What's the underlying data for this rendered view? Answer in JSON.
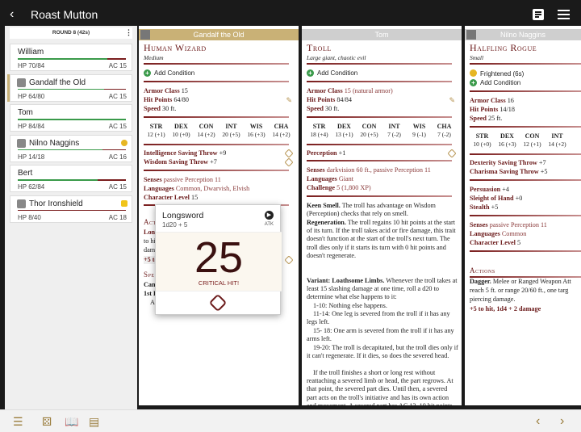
{
  "topbar": {
    "title": "Roast Mutton"
  },
  "sidebar": {
    "round": "ROUND 8 (42s)",
    "combatants": [
      {
        "name": "William",
        "hp": "HP 70/84",
        "ac": "AC 15",
        "hp_fraction": 0.83,
        "avatar": false,
        "active": false,
        "badge": ""
      },
      {
        "name": "Gandalf the Old",
        "hp": "HP 64/80",
        "ac": "AC 15",
        "hp_fraction": 0.8,
        "avatar": true,
        "active": true,
        "badge": ""
      },
      {
        "name": "Tom",
        "hp": "HP 84/84",
        "ac": "AC 15",
        "hp_fraction": 1.0,
        "avatar": false,
        "active": false,
        "badge": ""
      },
      {
        "name": "Nilno Naggins",
        "hp": "HP 14/18",
        "ac": "AC 16",
        "hp_fraction": 0.78,
        "avatar": true,
        "active": false,
        "badge": "frightened"
      },
      {
        "name": "Bert",
        "hp": "HP 62/84",
        "ac": "AC 15",
        "hp_fraction": 0.74,
        "avatar": false,
        "active": false,
        "badge": ""
      },
      {
        "name": "Thor Ironshield",
        "hp": "HP 8/40",
        "ac": "AC 18",
        "hp_fraction": 0.2,
        "avatar": true,
        "active": false,
        "badge": "hand"
      }
    ]
  },
  "columns": {
    "gandalf": {
      "header": "Gandalf the Old",
      "header_color": "#c9b176",
      "name": "Human Wizard",
      "type": "Medium",
      "add_condition": "Add Condition",
      "armor_class_label": "Armor Class",
      "armor_class": "15",
      "hp_label": "Hit Points",
      "hp": "64/80",
      "speed_label": "Speed",
      "speed": "30 ft.",
      "abilities": [
        {
          "k": "STR",
          "v": "12 (+1)"
        },
        {
          "k": "DEX",
          "v": "10 (+0)"
        },
        {
          "k": "CON",
          "v": "14 (+2)"
        },
        {
          "k": "INT",
          "v": "20 (+5)"
        },
        {
          "k": "WIS",
          "v": "16 (+3)"
        },
        {
          "k": "CHA",
          "v": "14 (+2)"
        }
      ],
      "saves": [
        {
          "label": "Intelligence Saving Throw",
          "value": "+9"
        },
        {
          "label": "Wisdom Saving Throw",
          "value": "+7"
        }
      ],
      "senses_label": "Senses",
      "senses": "passive Perception 11",
      "languages_label": "Languages",
      "languages": "Common, Dwarvish, Elvish",
      "charlevel_label": "Character Level",
      "charlevel": "15",
      "actions_title": "Acti",
      "action_frag1": "Long",
      "action_frag2": "to hit,",
      "action_frag3": "dama",
      "action_frag4": "+5 to",
      "spells_title": "Spe",
      "spell_frag1": "Cant",
      "spell_frag2": "1st L",
      "spell_frag3": "Ar"
    },
    "tom": {
      "header": "Tom",
      "header_color": "#cfcfcf",
      "name": "Troll",
      "type": "Large giant, chaotic evil",
      "add_condition": "Add Condition",
      "armor_class_label": "Armor Class",
      "armor_class": "15 (natural armor)",
      "hp_label": "Hit Points",
      "hp": "84/84",
      "speed_label": "Speed",
      "speed": "30 ft.",
      "abilities": [
        {
          "k": "STR",
          "v": "18 (+4)"
        },
        {
          "k": "DEX",
          "v": "13 (+1)"
        },
        {
          "k": "CON",
          "v": "20 (+5)"
        },
        {
          "k": "INT",
          "v": "7 (-2)"
        },
        {
          "k": "WIS",
          "v": "9 (-1)"
        },
        {
          "k": "CHA",
          "v": "7 (-2)"
        }
      ],
      "perception_label": "Perception",
      "perception": "+1",
      "senses_label": "Senses",
      "senses": "darkvision 60 ft., passive Perception 11",
      "languages_label": "Languages",
      "languages": "Giant",
      "challenge_label": "Challenge",
      "challenge": "5 (1,800 XP)",
      "keen_title": "Keen Smell.",
      "keen_text": "The troll has advantage on Wisdom (Perception) checks that rely on smell.",
      "regen_title": "Regeneration.",
      "regen_text": "The troll regains 10 hit points at the start of its turn. If the troll takes acid or fire damage, this trait doesn't function at the start of the troll's next turn. The troll dies only if it starts its turn with 0 hit points and doesn't regenerate.",
      "variant_title": "Variant: Loathsome Limbs.",
      "variant_text": "Whenever the troll takes at least 15 slashing damage at one time, roll a d20 to determine what else happens to it:",
      "v1": "1-10: Nothing else happens.",
      "v2": "11-14: One leg is severed from the troll if it has any legs left.",
      "v3": "15- 18: One arm is severed from the troll if it has any arms left.",
      "v4": "19-20: The troll is decapitated, but the troll dies only if it can't regenerate. If it dies, so does the severed head.",
      "v5": "If the troll finishes a short or long rest without reattaching a severed limb or head, the part regrows. At that point, the severed part dies. Until then, a severed part acts on the troll's initiative and has its own action and movement. A severed part has AC 13, 10 hit points, and the troll's"
    },
    "nilno": {
      "header": "Nilno Naggins",
      "header_color": "#cfcfcf",
      "name": "Halfling Rogue",
      "type": "Small",
      "frightened": "Frightened (6s)",
      "add_condition": "Add Condition",
      "armor_class_label": "Armor Class",
      "armor_class": "16",
      "hp_label": "Hit Points",
      "hp": "14/18",
      "speed_label": "Speed",
      "speed": "25 ft.",
      "abilities": [
        {
          "k": "STR",
          "v": "10 (+0)"
        },
        {
          "k": "DEX",
          "v": "16 (+3)"
        },
        {
          "k": "CON",
          "v": "12 (+1)"
        },
        {
          "k": "INT",
          "v": "14 (+2)"
        }
      ],
      "saves": [
        {
          "label": "Dexterity Saving Throw",
          "value": "+7"
        },
        {
          "label": "Charisma Saving Throw",
          "value": "+5"
        }
      ],
      "skills": [
        {
          "label": "Persuasion",
          "value": "+4"
        },
        {
          "label": "Sleight of Hand",
          "value": "+0"
        },
        {
          "label": "Stealth",
          "value": "+5"
        }
      ],
      "senses_label": "Senses",
      "senses": "passive Perception 11",
      "languages_label": "Languages",
      "languages": "Common",
      "charlevel_label": "Character Level",
      "charlevel": "5",
      "actions_title": "Actions",
      "dagger_title": "Dagger.",
      "dagger_text1": "Melee or Ranged Weapon Att",
      "dagger_text2": "reach 5 ft. or range 20/60 ft., one targ",
      "dagger_text3": "piercing damage.",
      "dagger_roll": "+5 to hit, 1d4 + 2 damage"
    }
  },
  "popup": {
    "title": "Longsword",
    "formula": "1d20 + 5",
    "atk": "ATK",
    "result": "25",
    "note": "CRITICAL HIT!"
  }
}
